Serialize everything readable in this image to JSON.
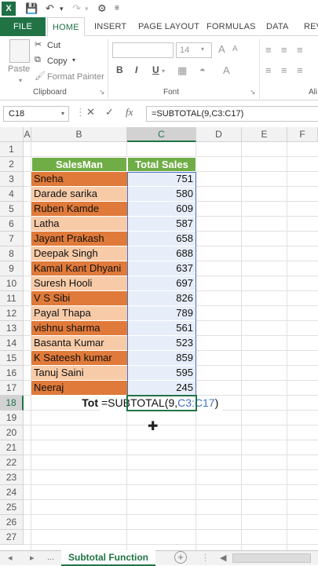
{
  "app": {
    "icon_label": "X"
  },
  "ribbon_tabs": [
    {
      "label": "FILE"
    },
    {
      "label": "HOME"
    },
    {
      "label": "INSERT"
    },
    {
      "label": "PAGE LAYOUT"
    },
    {
      "label": "FORMULAS"
    },
    {
      "label": "DATA"
    },
    {
      "label": "REV"
    }
  ],
  "clipboard": {
    "paste": "Paste",
    "cut": "Cut",
    "copy": "Copy",
    "format_painter": "Format Painter",
    "group_label": "Clipboard"
  },
  "font": {
    "size": "14",
    "bold": "B",
    "italic": "I",
    "underline": "U",
    "group_label": "Font"
  },
  "alignment": {
    "group_label": "Ali"
  },
  "formula_bar": {
    "name_box": "C18",
    "fx": "fx",
    "formula": "=SUBTOTAL(9,C3:C17)"
  },
  "columns": [
    "A",
    "B",
    "C",
    "D",
    "E",
    "F"
  ],
  "rows": [
    "1",
    "2",
    "3",
    "4",
    "5",
    "6",
    "7",
    "8",
    "9",
    "10",
    "11",
    "12",
    "13",
    "14",
    "15",
    "16",
    "17",
    "18",
    "19",
    "20",
    "21",
    "22",
    "23",
    "24",
    "25",
    "26",
    "27"
  ],
  "table": {
    "header_name": "SalesMan",
    "header_sales": "Total Sales",
    "rows": [
      {
        "name": "Sneha",
        "sales": "751"
      },
      {
        "name": "Darade sarika",
        "sales": "580"
      },
      {
        "name": "Ruben Kamde",
        "sales": "609"
      },
      {
        "name": "Latha",
        "sales": "587"
      },
      {
        "name": "Jayant Prakash",
        "sales": "658"
      },
      {
        "name": "Deepak Singh",
        "sales": "688"
      },
      {
        "name": "Kamal Kant Dhyani",
        "sales": "637"
      },
      {
        "name": "Suresh Hooli",
        "sales": "697"
      },
      {
        "name": "V S Sibi",
        "sales": "826"
      },
      {
        "name": "Payal Thapa",
        "sales": "789"
      },
      {
        "name": "vishnu sharma",
        "sales": "561"
      },
      {
        "name": "Basanta Kumar",
        "sales": "523"
      },
      {
        "name": "K Sateesh kumar",
        "sales": "859"
      },
      {
        "name": "Tanuj Saini",
        "sales": "595"
      },
      {
        "name": "Neeraj",
        "sales": "245"
      }
    ],
    "total_label": "Tot",
    "edit_prefix": "=SUBTOTAL(9,",
    "edit_range": "C3:C17",
    "edit_suffix": ")"
  },
  "colors": {
    "dark_orange": "#e07a3a",
    "light_orange": "#f8cba8",
    "value_bg": "#e7eef9",
    "header_green": "#70ad47",
    "excel_green": "#217346",
    "range_blue": "#4472c4"
  },
  "sheet_bar": {
    "prev_icon": "◂",
    "next_icon": "▸",
    "ellipsis": "...",
    "active_sheet": "Subtotal Function",
    "add_icon": "+"
  }
}
